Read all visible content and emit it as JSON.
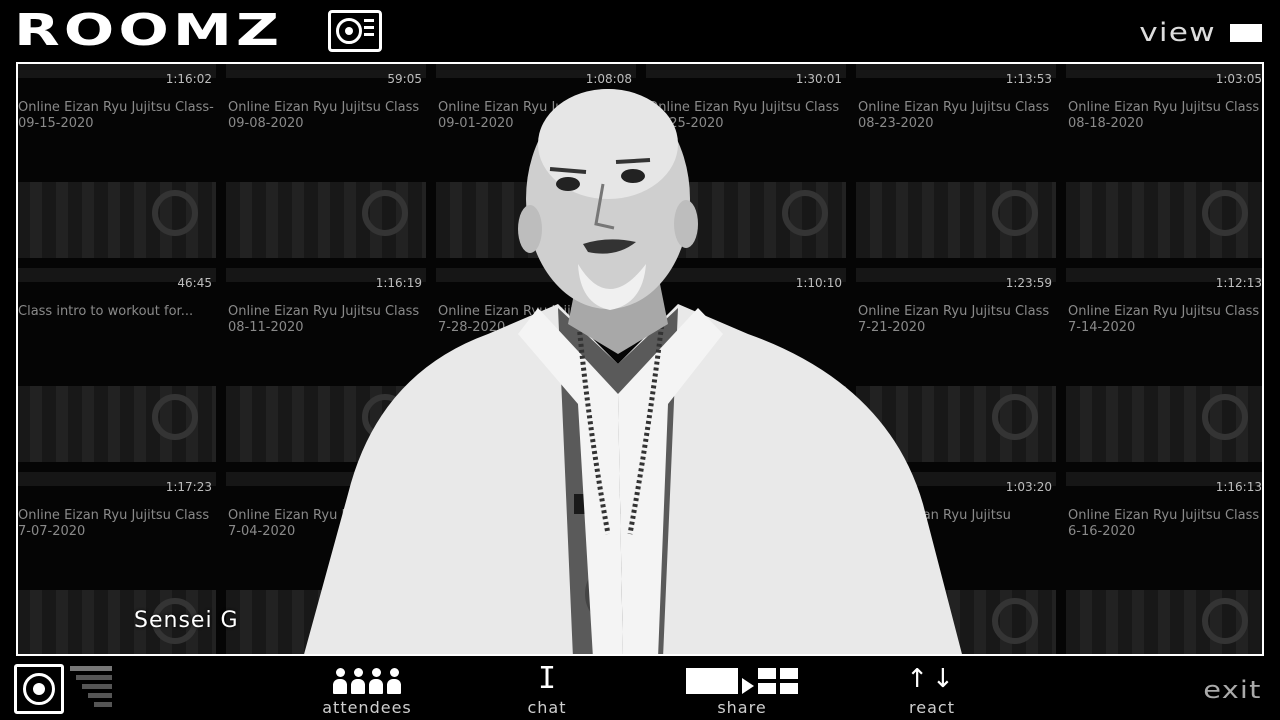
{
  "app": {
    "name": "ROOMZ",
    "view_label": "view",
    "exit_label": "exit"
  },
  "speaker": {
    "name": "Sensei G"
  },
  "toolbar": {
    "attendees": "attendees",
    "chat": "chat",
    "share": "share",
    "react": "react"
  },
  "videos": [
    {
      "duration": "1:16:02",
      "title": "Online Eizan Ryu Jujitsu Class-09-15-2020"
    },
    {
      "duration": "59:05",
      "title": "Online Eizan Ryu Jujitsu Class 09-08-2020"
    },
    {
      "duration": "1:08:08",
      "title": "Online Eizan Ryu Jujitsu Class 09-01-2020"
    },
    {
      "duration": "1:30:01",
      "title": "Online Eizan Ryu Jujitsu Class 08-25-2020"
    },
    {
      "duration": "1:13:53",
      "title": "Online Eizan Ryu Jujitsu Class 08-23-2020"
    },
    {
      "duration": "1:03:05",
      "title": "Online Eizan Ryu Jujitsu Class 08-18-2020"
    },
    {
      "duration": "46:45",
      "title": "Class intro to workout for..."
    },
    {
      "duration": "1:16:19",
      "title": "Online Eizan Ryu Jujitsu Class 08-11-2020"
    },
    {
      "duration": "",
      "title": "Online Eizan Ryu Jujitsu Class 7-28-2020"
    },
    {
      "duration": "1:10:10",
      "title": ""
    },
    {
      "duration": "1:23:59",
      "title": "Online Eizan Ryu Jujitsu Class 7-21-2020"
    },
    {
      "duration": "1:12:13",
      "title": "Online Eizan Ryu Jujitsu Class 7-14-2020"
    },
    {
      "duration": "1:17:23",
      "title": "Online Eizan Ryu Jujitsu Class 7-07-2020"
    },
    {
      "duration": "",
      "title": "Online Eizan Ryu Jujitsu Class 7-04-2020"
    },
    {
      "duration": "",
      "title": ""
    },
    {
      "duration": "",
      "title": ""
    },
    {
      "duration": "1:03:20",
      "title": "Online Eizan Ryu Jujitsu"
    },
    {
      "duration": "1:16:13",
      "title": "Online Eizan Ryu Jujitsu Class 6-16-2020"
    }
  ],
  "icons": {
    "logo": "turntable-icon",
    "view": "view-square-icon",
    "me": "self-camera-icon",
    "level": "audio-level-icon",
    "attendees": "people-icon",
    "chat": "text-cursor-icon",
    "share": "share-screen-icon",
    "react": "up-down-arrows-icon"
  },
  "colors": {
    "background": "#000000",
    "foreground": "#ffffff",
    "muted": "#8a8a8a"
  }
}
